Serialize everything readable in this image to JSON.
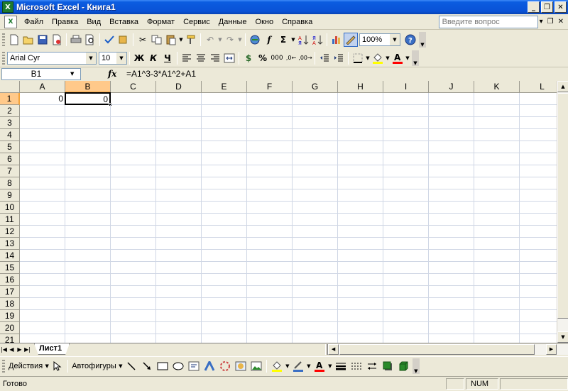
{
  "window": {
    "title": "Microsoft Excel - Книга1",
    "app_icon": "X",
    "controls": [
      "_",
      "❐",
      "✕"
    ]
  },
  "menu": {
    "items": [
      "Файл",
      "Правка",
      "Вид",
      "Вставка",
      "Формат",
      "Сервис",
      "Данные",
      "Окно",
      "Справка"
    ],
    "help_placeholder": "Введите вопрос",
    "tail": [
      "▾",
      "❐",
      "✕"
    ]
  },
  "standard_toolbar": {
    "icons": [
      "new-icon",
      "open-icon",
      "save-icon",
      "permission-icon",
      "print-icon",
      "print-preview-icon",
      "spelling-icon",
      "research-icon",
      "cut-icon",
      "copy-icon",
      "paste-icon",
      "format-painter-icon",
      "undo-icon",
      "redo-icon",
      "hyperlink-icon",
      "function-icon",
      "autosum-icon",
      "sort-asc-icon",
      "sort-desc-icon",
      "chart-wizard-icon",
      "drawing-icon",
      "help-icon"
    ],
    "zoom": "100%"
  },
  "formatting_toolbar": {
    "font_name": "Arial Cyr",
    "font_size": "10",
    "bold": "Ж",
    "italic": "К",
    "underline": "Ч",
    "currency": "$",
    "percent": "%",
    "thousands": "000"
  },
  "formula_bar": {
    "name_box": "B1",
    "fx": "fx",
    "formula": "=A1^3-3*A1^2+A1"
  },
  "sheet": {
    "columns": [
      "A",
      "B",
      "C",
      "D",
      "E",
      "F",
      "G",
      "H",
      "I",
      "J",
      "K",
      "L"
    ],
    "rows": [
      "1",
      "2",
      "3",
      "4",
      "5",
      "6",
      "7",
      "8",
      "9",
      "10",
      "11",
      "12",
      "13",
      "14",
      "15",
      "16",
      "17",
      "18",
      "19",
      "20",
      "21"
    ],
    "selected_column": "B",
    "selected_row": "1",
    "cells": {
      "A1": "0",
      "B1": "0"
    }
  },
  "tabs": {
    "nav": [
      "|◀",
      "◀",
      "▶",
      "▶|"
    ],
    "sheets": [
      "Лист1"
    ]
  },
  "drawing_toolbar": {
    "actions_label": "Действия",
    "autoshapes_label": "Автофигуры"
  },
  "status": {
    "ready": "Готово",
    "num": "NUM"
  }
}
